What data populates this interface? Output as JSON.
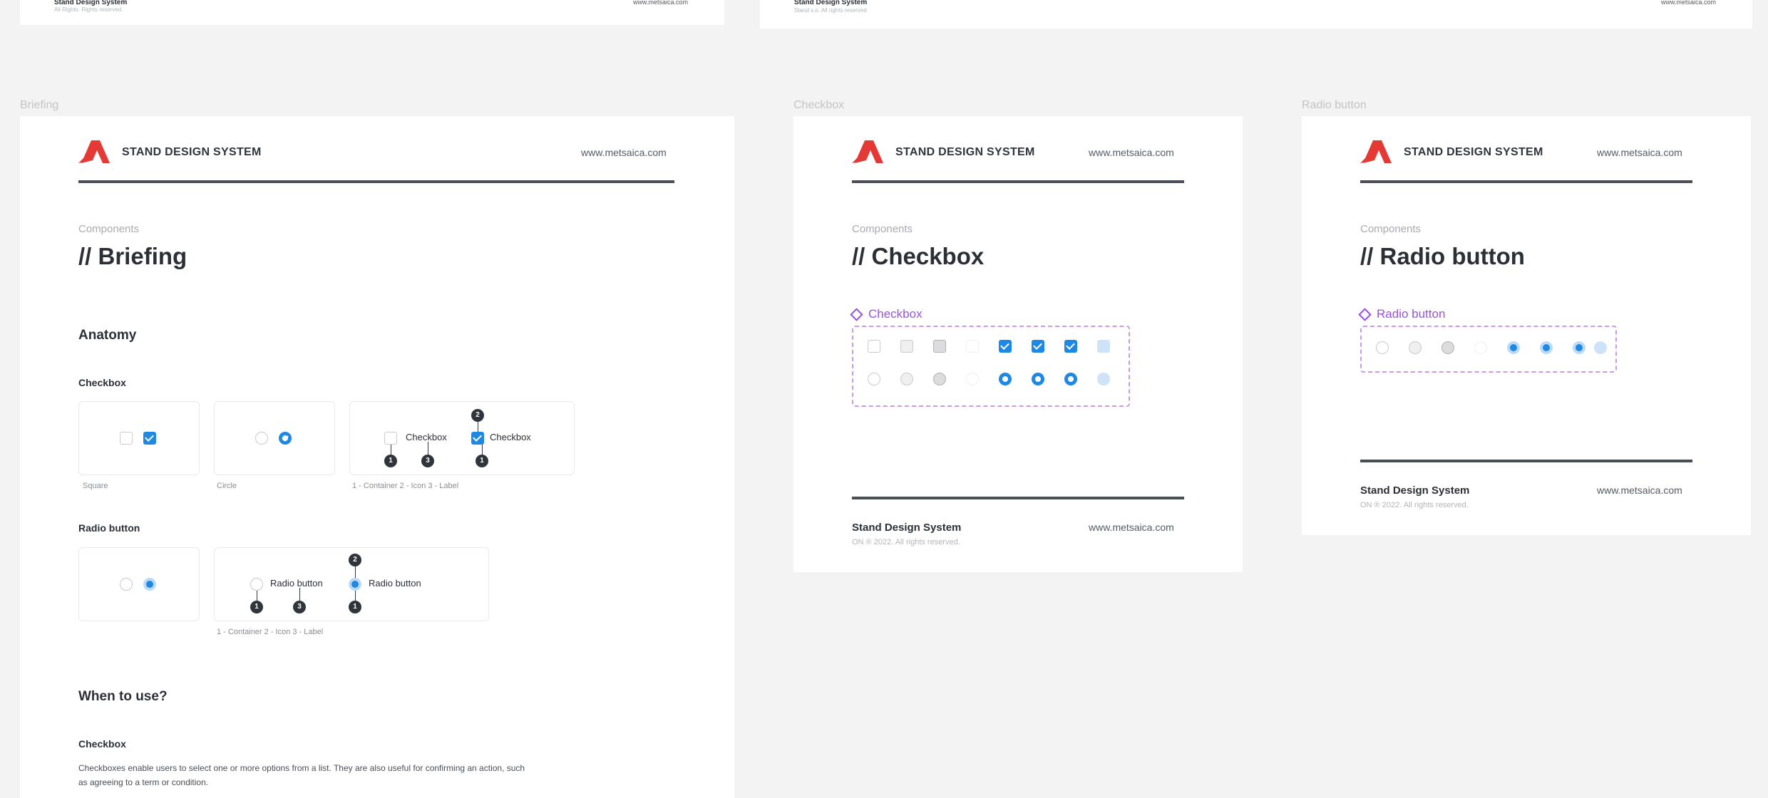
{
  "frames": {
    "briefing_label": "Briefing",
    "checkbox_label": "Checkbox",
    "radio_label": "Radio button"
  },
  "brand": {
    "name": "STAND DESIGN SYSTEM",
    "url": "www.metsaica.com",
    "logo_color": "#e53935"
  },
  "top_strip": {
    "left_title": "Stand Design System",
    "left_sub": "All Rights. Rights reserved.",
    "left_url": "www.metsaica.com",
    "right_title": "Stand Design System",
    "right_sub": "Stand s.o. All rights reserved",
    "right_url": "www.metsaica.com"
  },
  "briefing": {
    "eyebrow": "Components",
    "title": "// Briefing",
    "anatomy": "Anatomy",
    "checkbox_heading": "Checkbox",
    "caption_square": "Square",
    "caption_circle": "Circle",
    "checkbox_label_a": "Checkbox",
    "checkbox_label_b": "Checkbox",
    "checkbox_legend": "1 - Container  2 - Icon  3 - Label",
    "radio_heading": "Radio button",
    "radio_label_a": "Radio button",
    "radio_label_b": "Radio button",
    "radio_legend": "1 - Container  2 - Icon  3 - Label",
    "when_to_use": "When to use?",
    "when_checkbox": "Checkbox",
    "when_text_1": "Checkboxes enable users to select one or more options from a list. They are also useful for confirming an action, such",
    "when_text_2": "as agreeing to a term or condition.",
    "badge_1": "1",
    "badge_2": "2",
    "badge_3": "3"
  },
  "checkbox_page": {
    "eyebrow": "Components",
    "title": "// Checkbox",
    "variant_title": "Checkbox",
    "footer_title": "Stand Design System",
    "footer_sub": "ON ® 2022. All rights reserved.",
    "footer_url": "www.metsaica.com"
  },
  "radio_page": {
    "eyebrow": "Components",
    "title": "// Radio button",
    "variant_title": "Radio button",
    "footer_title": "Stand Design System",
    "footer_sub": "ON ® 2022. All rights reserved.",
    "footer_url": "www.metsaica.com"
  },
  "colors": {
    "accent": "#1e88e5",
    "variant_purple": "#9b51e0",
    "rule": "#4a4f57"
  }
}
